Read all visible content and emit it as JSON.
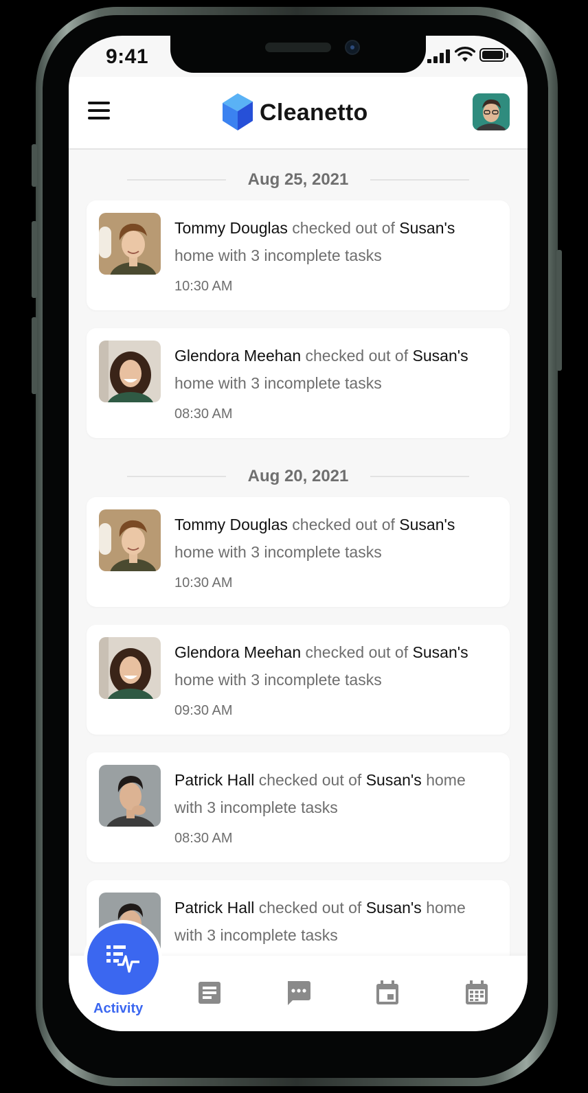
{
  "status_bar": {
    "time": "9:41"
  },
  "header": {
    "app_name": "Cleanetto"
  },
  "colors": {
    "accent": "#3b67f0",
    "logo_light": "#5ab2f5",
    "logo_dark": "#2650d8"
  },
  "feed": [
    {
      "date": "Aug 25, 2021",
      "items": [
        {
          "person": "Tommy Douglas",
          "action": "checked out of",
          "place": "Susan's",
          "detail": "home with 3 incomplete tasks",
          "time": "10:30 AM",
          "avatar": "tommy"
        },
        {
          "person": "Glendora Meehan",
          "action": "checked out of",
          "place": "Susan's",
          "detail": "home with 3 incomplete tasks",
          "time": "08:30 AM",
          "avatar": "glendora"
        }
      ]
    },
    {
      "date": "Aug 20, 2021",
      "items": [
        {
          "person": "Tommy Douglas",
          "action": "checked out of",
          "place": "Susan's",
          "detail": "home with 3 incomplete tasks",
          "time": "10:30 AM",
          "avatar": "tommy"
        },
        {
          "person": "Glendora Meehan",
          "action": "checked out of",
          "place": "Susan's",
          "detail": "home with 3 incomplete tasks",
          "time": "09:30 AM",
          "avatar": "glendora"
        },
        {
          "person": "Patrick Hall",
          "action": "checked out of",
          "place": "Susan's",
          "detail": "home with 3 incomplete tasks",
          "time": "08:30 AM",
          "avatar": "patrick"
        },
        {
          "person": "Patrick Hall",
          "action": "checked out of",
          "place": "Susan's",
          "detail": "home with 3 incomplete tasks",
          "time": "",
          "avatar": "patrick"
        }
      ]
    }
  ],
  "tabbar": {
    "active_label": "Activity",
    "tabs": [
      {
        "icon": "activity-icon"
      },
      {
        "icon": "notes-icon"
      },
      {
        "icon": "chat-icon"
      },
      {
        "icon": "event-icon"
      },
      {
        "icon": "calendar-icon"
      }
    ]
  }
}
